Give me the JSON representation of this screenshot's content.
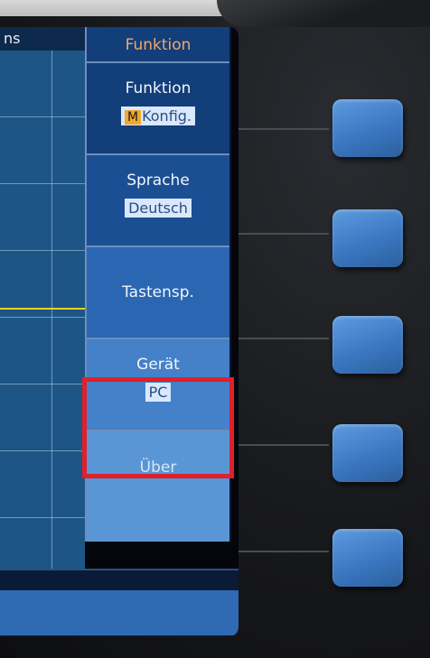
{
  "scope": {
    "title": "ns"
  },
  "menu": {
    "header": "Funktion",
    "items": [
      {
        "label": "Funktion",
        "badge": "M",
        "value": "Konfig."
      },
      {
        "label": "Sprache",
        "value": "Deutsch"
      },
      {
        "label": "Tastensp.",
        "value": ""
      },
      {
        "label": "Gerät",
        "value": "PC",
        "highlighted": true
      },
      {
        "label": "Über",
        "value": ""
      }
    ]
  },
  "colors": {
    "menu_header_text": "#f0a86a",
    "highlight_box": "#e0202a",
    "trace": "#f2d11c",
    "hardware_button": "#3b78c2"
  }
}
